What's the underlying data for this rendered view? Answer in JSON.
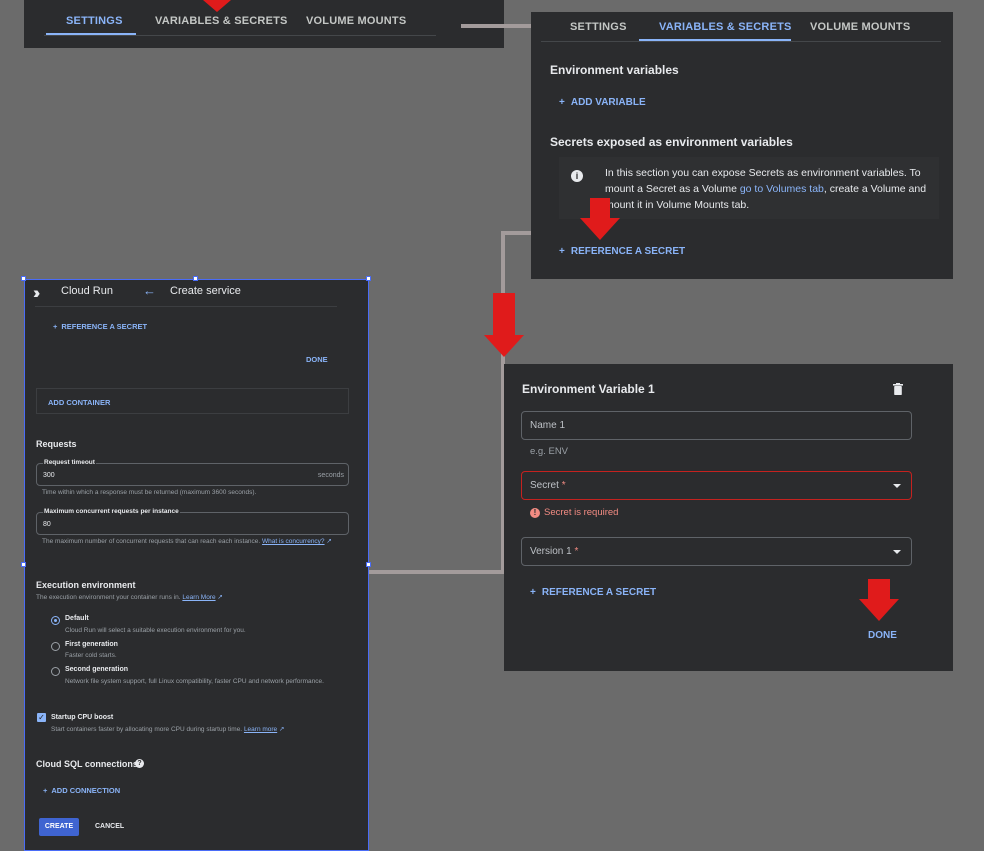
{
  "top_left_tabs": {
    "settings": "SETTINGS",
    "variables": "VARIABLES & SECRETS",
    "volumes": "VOLUME MOUNTS"
  },
  "top_right": {
    "tabs": {
      "settings": "SETTINGS",
      "variables": "VARIABLES & SECRETS",
      "volumes": "VOLUME MOUNTS"
    },
    "env_heading": "Environment variables",
    "add_variable": "ADD VARIABLE",
    "secrets_heading": "Secrets exposed as environment variables",
    "info_text_1": "In this section you can expose Secrets as environment variables. To mount a Secret as a Volume ",
    "info_link": "go to Volumes tab",
    "info_text_2": ", create a Volume and mount it in Volume Mounts tab.",
    "reference_secret": "REFERENCE A SECRET"
  },
  "left_panel": {
    "app_name": "Cloud Run",
    "page_title": "Create service",
    "reference_secret": "REFERENCE A SECRET",
    "done": "DONE",
    "add_container": "ADD CONTAINER",
    "requests_heading": "Requests",
    "timeout_label": "Request timeout",
    "timeout_value": "300",
    "timeout_unit": "seconds",
    "timeout_help": "Time within which a response must be returned (maximum 3600 seconds).",
    "concurrency_label": "Maximum concurrent requests per instance",
    "concurrency_value": "80",
    "concurrency_help": "The maximum number of concurrent requests that can reach each instance.",
    "concurrency_link": "What is concurrency?",
    "exec_heading": "Execution environment",
    "exec_help": "The execution environment your container runs in.",
    "exec_learn_more": "Learn More",
    "options": [
      {
        "title": "Default",
        "desc": "Cloud Run will select a suitable execution environment for you."
      },
      {
        "title": "First generation",
        "desc": "Faster cold starts."
      },
      {
        "title": "Second generation",
        "desc": "Network file system support, full Linux compatibility, faster CPU and network performance."
      }
    ],
    "startup_boost": "Startup CPU boost",
    "startup_boost_desc": "Start containers faster by allocating more CPU during startup time.",
    "startup_learn_more": "Learn more",
    "sql_heading": "Cloud SQL connections",
    "add_connection": "ADD CONNECTION",
    "create": "CREATE",
    "cancel": "CANCEL"
  },
  "bottom_right": {
    "title": "Environment Variable 1",
    "name_placeholder": "Name 1",
    "name_hint": "e.g. ENV",
    "secret_label": "Secret",
    "required_mark": "*",
    "secret_error": "Secret is required",
    "version_label": "Version 1",
    "reference_secret": "REFERENCE A SECRET",
    "done": "DONE"
  },
  "colors": {
    "accent": "#8ab4f8",
    "error": "#f28b82",
    "arrow": "#e01b1b",
    "panel": "#2b2c2e"
  }
}
